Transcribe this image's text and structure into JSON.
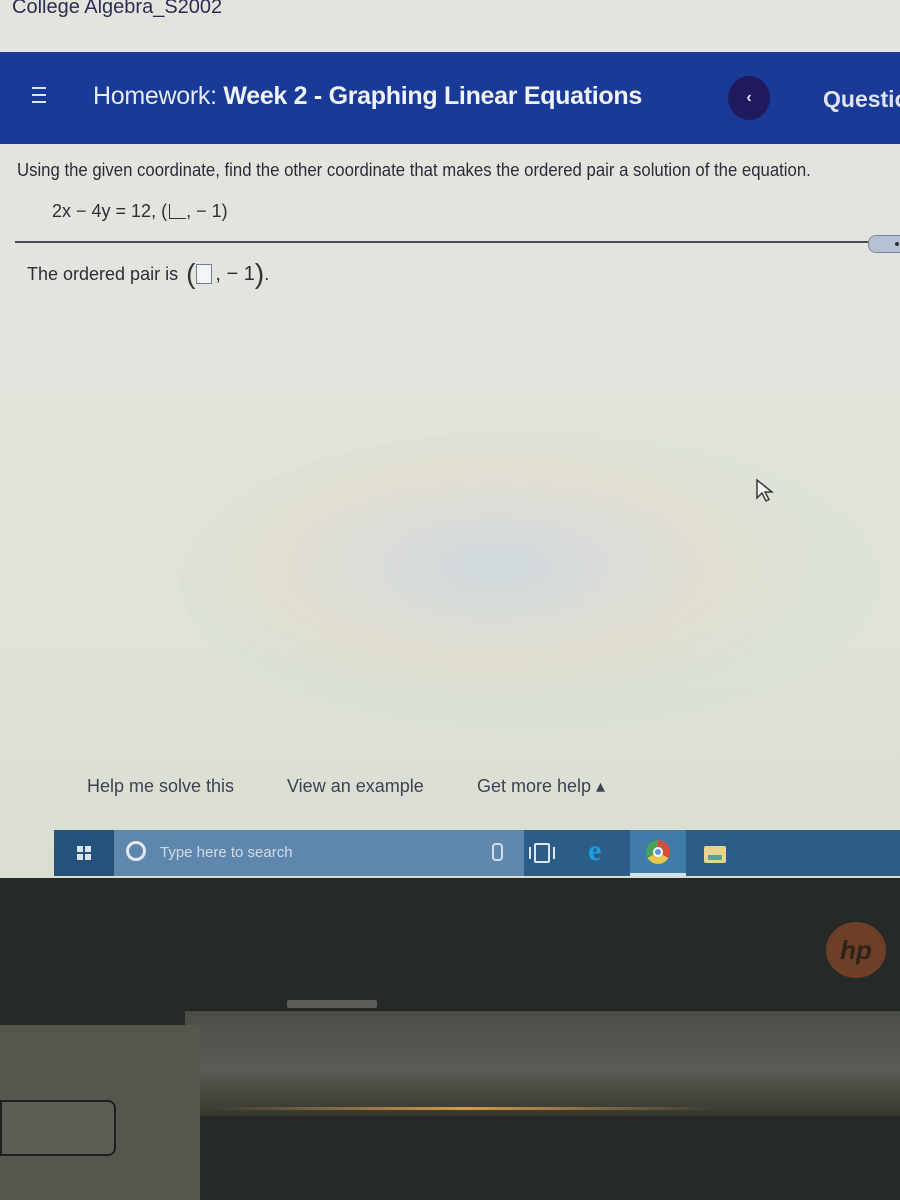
{
  "course": {
    "title": "College Algebra_S2002"
  },
  "header": {
    "menu_icon": "hamburger-menu-icon",
    "homework_prefix": "Homework:",
    "homework_title": "Week 2 - Graphing Linear Equations",
    "prev_button_glyph": "‹",
    "question_label": "Questio"
  },
  "question": {
    "instruction": "Using the given coordinate, find the other coordinate that makes the ordered pair a solution of the equation.",
    "equation": "2x − 4y = 12,",
    "given_pair_open": "(",
    "given_pair_close": ", − 1)",
    "answer_prefix": "The ordered pair is",
    "answer_open": "(",
    "answer_value": "",
    "answer_given": ", − 1",
    "answer_close": ")",
    "answer_period": "."
  },
  "help": {
    "help_me_solve": "Help me solve this",
    "view_example": "View an example",
    "get_more_help": "Get more help ▴"
  },
  "taskbar": {
    "search_placeholder": "Type here to search",
    "apps": [
      "task-view",
      "edge",
      "chrome",
      "file-explorer"
    ]
  },
  "device": {
    "logo": "hp"
  }
}
